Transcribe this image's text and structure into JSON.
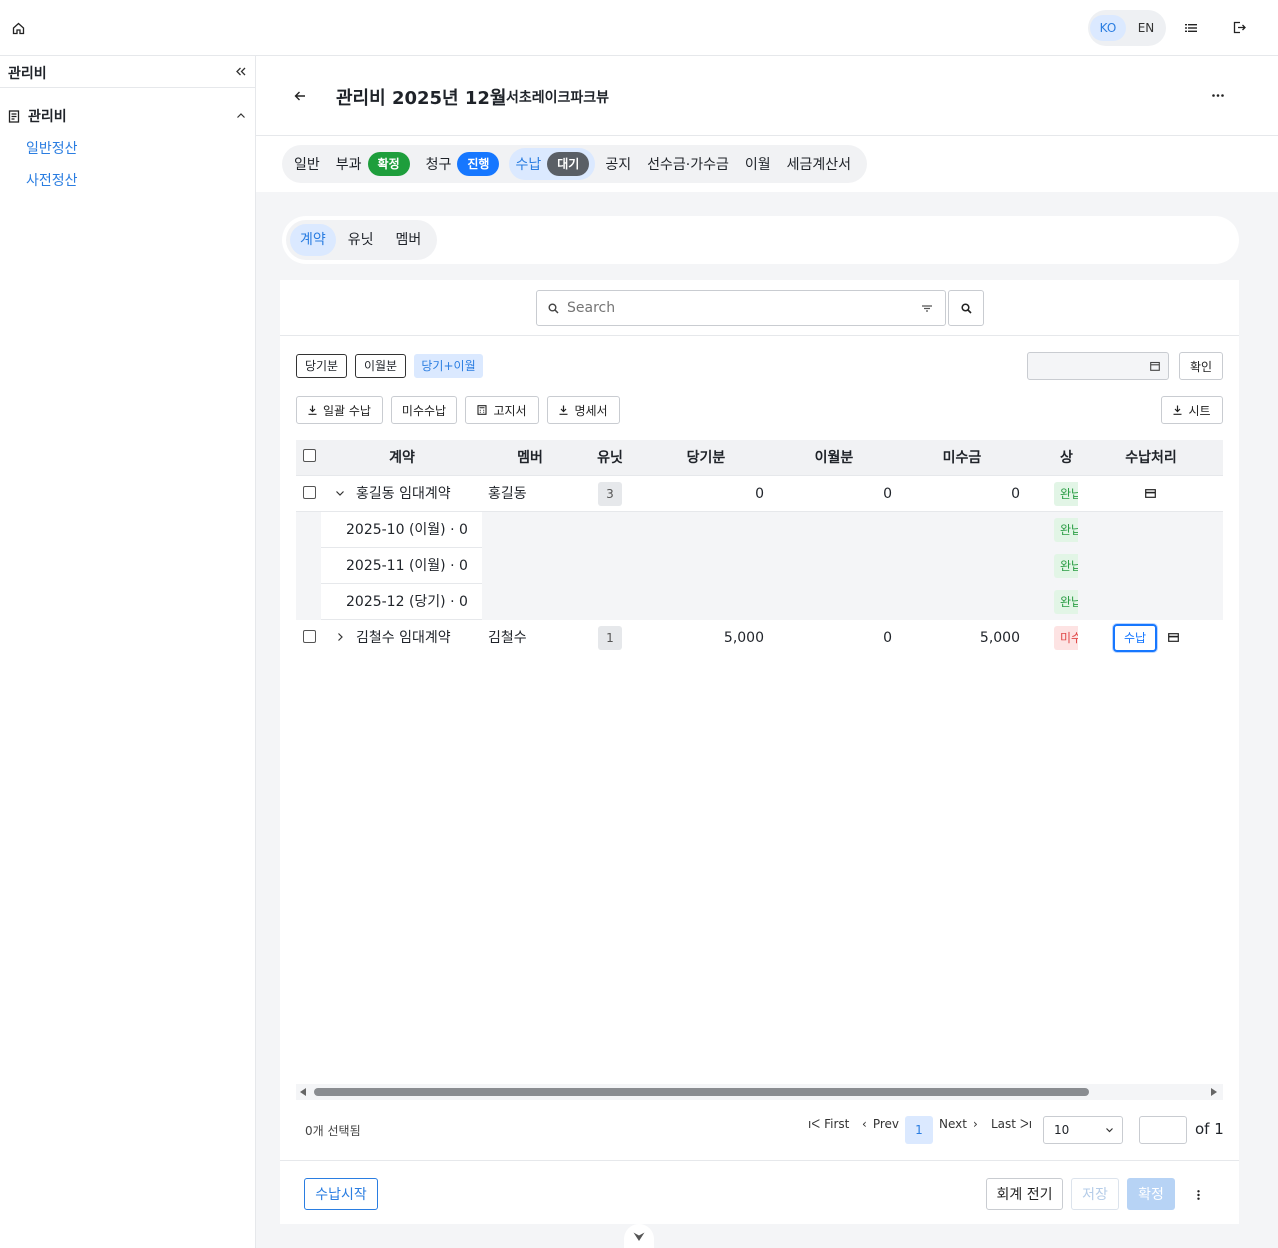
{
  "topbar": {
    "lang_ko": "KO",
    "lang_en": "EN"
  },
  "sidebar": {
    "title": "관리비",
    "group_label": "관리비",
    "items": [
      {
        "label": "일반정산"
      },
      {
        "label": "사전정산"
      }
    ]
  },
  "header": {
    "title": "관리비 2025년 12월",
    "subtitle": "서초레이크파크뷰"
  },
  "tabs": [
    {
      "label": "일반"
    },
    {
      "label": "부과",
      "badge": "확정",
      "badge_color": "#1e9e3c"
    },
    {
      "label": "청구",
      "badge": "진행",
      "badge_color": "#1677ff"
    },
    {
      "label": "수납",
      "badge": "대기",
      "badge_color": "#5a5f66",
      "active": true
    },
    {
      "label": "공지"
    },
    {
      "label": "선수금·가수금"
    },
    {
      "label": "이월"
    },
    {
      "label": "세금계산서"
    }
  ],
  "subtabs": [
    {
      "label": "계약",
      "active": true
    },
    {
      "label": "유닛"
    },
    {
      "label": "멤버"
    }
  ],
  "search": {
    "placeholder": "Search"
  },
  "filters": {
    "current": "당기분",
    "carried": "이월분",
    "both": "당기+이월"
  },
  "date_input": {
    "value": ""
  },
  "confirm_label": "확인",
  "actions": {
    "bulk": "일괄 수납",
    "unpaid": "미수수납",
    "notice": "고지서",
    "statement": "명세서",
    "sheet": "시트"
  },
  "table": {
    "headers": {
      "contract": "계약",
      "member": "멤버",
      "unit": "유닛",
      "current": "당기분",
      "carried": "이월분",
      "unpaid": "미수금",
      "status": "상태",
      "process": "수납처리"
    },
    "rows": [
      {
        "contract": "홍길동 임대계약",
        "member": "홍길동",
        "unit": "3",
        "current": "0",
        "carried": "0",
        "unpaid": "0",
        "status": "완납"
      },
      {
        "contract": "김철수 임대계약",
        "member": "김철수",
        "unit": "1",
        "current": "5,000",
        "carried": "0",
        "unpaid": "5,000",
        "status": "미수",
        "pay_button": "수납"
      }
    ],
    "subrows": [
      {
        "label": "2025-10 (이월) · 0",
        "status": "완납"
      },
      {
        "label": "2025-11 (이월) · 0",
        "status": "완납"
      },
      {
        "label": "2025-12 (당기) · 0",
        "status": "완납"
      }
    ]
  },
  "pagination": {
    "selected": "0개 선택됨",
    "first": "First",
    "prev": "Prev",
    "page": "1",
    "next": "Next",
    "last": "Last",
    "page_size": "10",
    "of": "of 1"
  },
  "footer": {
    "start": "수납시작",
    "journal": "회계 전기",
    "save": "저장",
    "finalize": "확정"
  }
}
